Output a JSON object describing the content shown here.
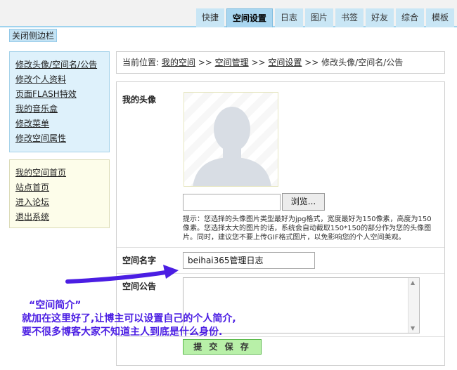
{
  "nav": {
    "tabs": [
      {
        "label": "快捷",
        "active": false
      },
      {
        "label": "空间设置",
        "active": true
      },
      {
        "label": "日志",
        "active": false
      },
      {
        "label": "图片",
        "active": false
      },
      {
        "label": "书签",
        "active": false
      },
      {
        "label": "好友",
        "active": false
      },
      {
        "label": "综合",
        "active": false
      },
      {
        "label": "模板",
        "active": false
      }
    ]
  },
  "sidebar": {
    "close_label": "关闭侧边栏",
    "group1": [
      "修改头像/空间名/公告",
      "修改个人资料",
      "页面FLASH特效",
      "我的音乐盒",
      "修改菜单",
      "修改空间属性"
    ],
    "group2": [
      "我的空间首页",
      "站点首页",
      "进入论坛",
      "退出系统"
    ]
  },
  "breadcrumb": {
    "prefix": "当前位置: ",
    "links": [
      "我的空间",
      "空间管理",
      "空间设置"
    ],
    "separator": " >> ",
    "current": "修改头像/空间名/公告"
  },
  "form": {
    "avatar_label": "我的头像",
    "browse_label": "浏览...",
    "tip": "提示：您选择的头像图片类型最好为jpg格式，宽度最好为150像素，高度为150像素。您选择太大的图片的话，系统会自动截取150*150的部分作为您的头像图片。同时，建议您不要上传GIF格式图片，以免影响您的个人空间美观。",
    "name_label": "空间名字",
    "name_value": "beihai365管理日志",
    "notice_label": "空间公告",
    "submit_label": "提 交 保 存"
  },
  "annotation": {
    "title": "“空间简介”",
    "line1": "就加在这里好了,让博主可以设置自己的个人简介,",
    "line2": "要不很多博客大家不知道主人到底是什么身份."
  },
  "colors": {
    "accent": "#a9d6f0",
    "annotation": "#4b1ee3",
    "submit": "#b8f0a8"
  }
}
